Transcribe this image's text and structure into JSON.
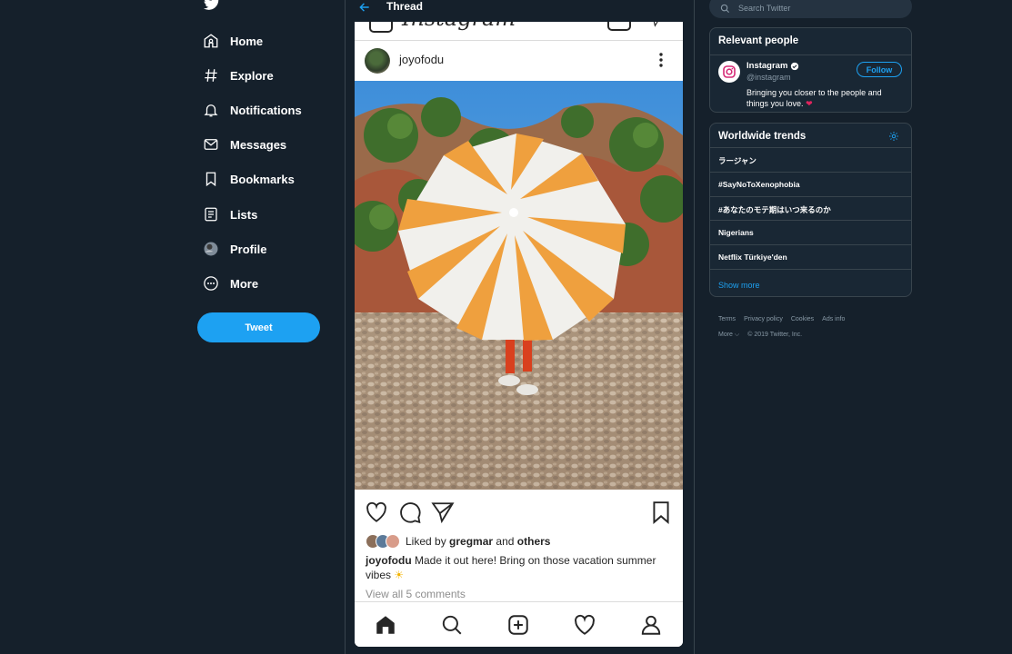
{
  "nav": {
    "items": [
      {
        "label": "Home",
        "icon": "home-icon"
      },
      {
        "label": "Explore",
        "icon": "hashtag-icon"
      },
      {
        "label": "Notifications",
        "icon": "bell-icon"
      },
      {
        "label": "Messages",
        "icon": "envelope-icon"
      },
      {
        "label": "Bookmarks",
        "icon": "bookmark-icon"
      },
      {
        "label": "Lists",
        "icon": "list-icon"
      },
      {
        "label": "Profile",
        "icon": "avatar"
      },
      {
        "label": "More",
        "icon": "more-circle-icon"
      }
    ],
    "tweet_label": "Tweet"
  },
  "thread": {
    "title": "Thread",
    "post": {
      "username": "joyofodu",
      "liked_by_prefix": "Liked by",
      "liked_by_user": "gregmar",
      "liked_by_and": "and",
      "liked_by_others": "others",
      "caption_user": "joyofodu",
      "caption_text": "Made it out here! Bring on those vacation summer vibes",
      "view_all": "View all 5 comments"
    }
  },
  "search": {
    "placeholder": "Search Twitter"
  },
  "relevant": {
    "title": "Relevant people",
    "name": "Instagram",
    "handle": "@instagram",
    "bio": "Bringing you closer to the people and things you love.",
    "follow_label": "Follow"
  },
  "trends": {
    "title": "Worldwide trends",
    "items": [
      "ラージャン",
      "#SayNoToXenophobia",
      "#あなたのモテ期はいつ来るのか",
      "Nigerians",
      "Netflix Türkiye'den"
    ],
    "show_more": "Show more"
  },
  "footer": {
    "links": [
      "Terms",
      "Privacy policy",
      "Cookies",
      "Ads info"
    ],
    "more": "More",
    "copyright": "© 2019 Twitter, Inc."
  },
  "colors": {
    "background": "#15202b",
    "accent": "#1da1f2",
    "card": "#192734",
    "border": "#38444d"
  }
}
